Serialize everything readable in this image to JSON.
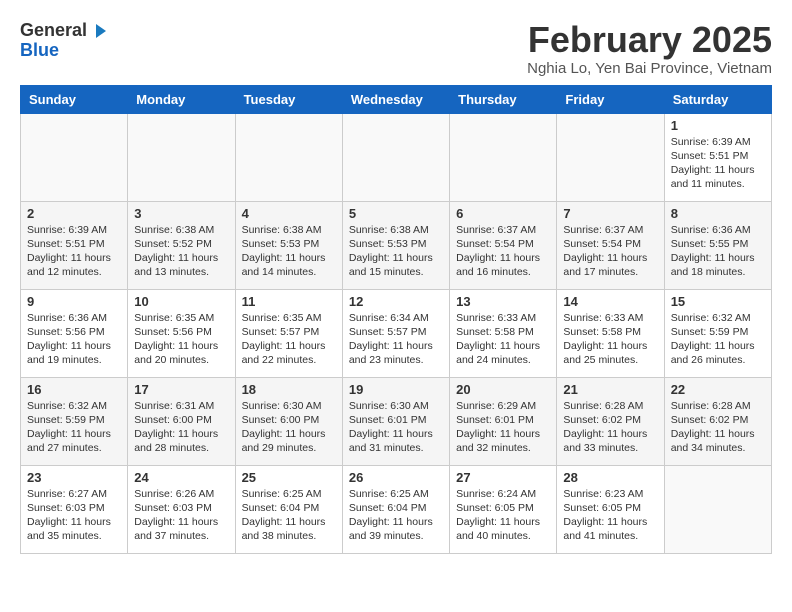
{
  "logo": {
    "general": "General",
    "blue": "Blue"
  },
  "title": "February 2025",
  "subtitle": "Nghia Lo, Yen Bai Province, Vietnam",
  "days_of_week": [
    "Sunday",
    "Monday",
    "Tuesday",
    "Wednesday",
    "Thursday",
    "Friday",
    "Saturday"
  ],
  "weeks": [
    [
      {
        "day": "",
        "info": ""
      },
      {
        "day": "",
        "info": ""
      },
      {
        "day": "",
        "info": ""
      },
      {
        "day": "",
        "info": ""
      },
      {
        "day": "",
        "info": ""
      },
      {
        "day": "",
        "info": ""
      },
      {
        "day": "1",
        "info": "Sunrise: 6:39 AM\nSunset: 5:51 PM\nDaylight: 11 hours\nand 11 minutes."
      }
    ],
    [
      {
        "day": "2",
        "info": "Sunrise: 6:39 AM\nSunset: 5:51 PM\nDaylight: 11 hours\nand 12 minutes."
      },
      {
        "day": "3",
        "info": "Sunrise: 6:38 AM\nSunset: 5:52 PM\nDaylight: 11 hours\nand 13 minutes."
      },
      {
        "day": "4",
        "info": "Sunrise: 6:38 AM\nSunset: 5:53 PM\nDaylight: 11 hours\nand 14 minutes."
      },
      {
        "day": "5",
        "info": "Sunrise: 6:38 AM\nSunset: 5:53 PM\nDaylight: 11 hours\nand 15 minutes."
      },
      {
        "day": "6",
        "info": "Sunrise: 6:37 AM\nSunset: 5:54 PM\nDaylight: 11 hours\nand 16 minutes."
      },
      {
        "day": "7",
        "info": "Sunrise: 6:37 AM\nSunset: 5:54 PM\nDaylight: 11 hours\nand 17 minutes."
      },
      {
        "day": "8",
        "info": "Sunrise: 6:36 AM\nSunset: 5:55 PM\nDaylight: 11 hours\nand 18 minutes."
      }
    ],
    [
      {
        "day": "9",
        "info": "Sunrise: 6:36 AM\nSunset: 5:56 PM\nDaylight: 11 hours\nand 19 minutes."
      },
      {
        "day": "10",
        "info": "Sunrise: 6:35 AM\nSunset: 5:56 PM\nDaylight: 11 hours\nand 20 minutes."
      },
      {
        "day": "11",
        "info": "Sunrise: 6:35 AM\nSunset: 5:57 PM\nDaylight: 11 hours\nand 22 minutes."
      },
      {
        "day": "12",
        "info": "Sunrise: 6:34 AM\nSunset: 5:57 PM\nDaylight: 11 hours\nand 23 minutes."
      },
      {
        "day": "13",
        "info": "Sunrise: 6:33 AM\nSunset: 5:58 PM\nDaylight: 11 hours\nand 24 minutes."
      },
      {
        "day": "14",
        "info": "Sunrise: 6:33 AM\nSunset: 5:58 PM\nDaylight: 11 hours\nand 25 minutes."
      },
      {
        "day": "15",
        "info": "Sunrise: 6:32 AM\nSunset: 5:59 PM\nDaylight: 11 hours\nand 26 minutes."
      }
    ],
    [
      {
        "day": "16",
        "info": "Sunrise: 6:32 AM\nSunset: 5:59 PM\nDaylight: 11 hours\nand 27 minutes."
      },
      {
        "day": "17",
        "info": "Sunrise: 6:31 AM\nSunset: 6:00 PM\nDaylight: 11 hours\nand 28 minutes."
      },
      {
        "day": "18",
        "info": "Sunrise: 6:30 AM\nSunset: 6:00 PM\nDaylight: 11 hours\nand 29 minutes."
      },
      {
        "day": "19",
        "info": "Sunrise: 6:30 AM\nSunset: 6:01 PM\nDaylight: 11 hours\nand 31 minutes."
      },
      {
        "day": "20",
        "info": "Sunrise: 6:29 AM\nSunset: 6:01 PM\nDaylight: 11 hours\nand 32 minutes."
      },
      {
        "day": "21",
        "info": "Sunrise: 6:28 AM\nSunset: 6:02 PM\nDaylight: 11 hours\nand 33 minutes."
      },
      {
        "day": "22",
        "info": "Sunrise: 6:28 AM\nSunset: 6:02 PM\nDaylight: 11 hours\nand 34 minutes."
      }
    ],
    [
      {
        "day": "23",
        "info": "Sunrise: 6:27 AM\nSunset: 6:03 PM\nDaylight: 11 hours\nand 35 minutes."
      },
      {
        "day": "24",
        "info": "Sunrise: 6:26 AM\nSunset: 6:03 PM\nDaylight: 11 hours\nand 37 minutes."
      },
      {
        "day": "25",
        "info": "Sunrise: 6:25 AM\nSunset: 6:04 PM\nDaylight: 11 hours\nand 38 minutes."
      },
      {
        "day": "26",
        "info": "Sunrise: 6:25 AM\nSunset: 6:04 PM\nDaylight: 11 hours\nand 39 minutes."
      },
      {
        "day": "27",
        "info": "Sunrise: 6:24 AM\nSunset: 6:05 PM\nDaylight: 11 hours\nand 40 minutes."
      },
      {
        "day": "28",
        "info": "Sunrise: 6:23 AM\nSunset: 6:05 PM\nDaylight: 11 hours\nand 41 minutes."
      },
      {
        "day": "",
        "info": ""
      }
    ]
  ]
}
